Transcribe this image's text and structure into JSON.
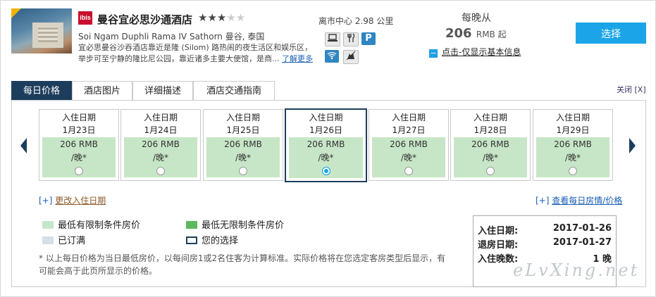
{
  "hotel": {
    "name": "曼谷宜必思沙通酒店",
    "brand": "ibis",
    "stars_filled": 3,
    "stars_total": 5,
    "address": "Soi Ngam Duphli Rama IV Sathorn 曼谷, 泰国",
    "desc_line1": "宜必思曼谷沙吞酒店靠近是隆 (Silom) 路热闹的夜生活区和娱乐区，",
    "desc_line2": "举步可至宁静的隆比尼公园，靠近诸多主要大使馆，是商...",
    "more_link": "了解更多",
    "distance": "离市中心 2.98 公里",
    "amenities": [
      "computer-icon",
      "restaurant-icon",
      "parking-icon",
      "wifi-icon",
      "pet-icon"
    ]
  },
  "pricing": {
    "label": "每晚从",
    "amount": "206",
    "currency": "RMB 起",
    "basic_info_link": "点击-仅显示基本信息",
    "select_button": "选择"
  },
  "tabs": [
    "每日价格",
    "酒店图片",
    "详细描述",
    "酒店交通指南"
  ],
  "close_label": "关闭 [X]",
  "calendar": {
    "checkin_label": "入住日期",
    "dates": [
      {
        "date": "1月23日",
        "price": "206 RMB",
        "per": "/晚*",
        "selected": false
      },
      {
        "date": "1月24日",
        "price": "206 RMB",
        "per": "/晚*",
        "selected": false
      },
      {
        "date": "1月25日",
        "price": "206 RMB",
        "per": "/晚*",
        "selected": false
      },
      {
        "date": "1月26日",
        "price": "206 RMB",
        "per": "/晚*",
        "selected": true
      },
      {
        "date": "1月27日",
        "price": "206 RMB",
        "per": "/晚*",
        "selected": false
      },
      {
        "date": "1月28日",
        "price": "206 RMB",
        "per": "/晚*",
        "selected": false
      },
      {
        "date": "1月29日",
        "price": "206 RMB",
        "per": "/晚*",
        "selected": false
      }
    ],
    "change_checkin_link": "更改入住日期",
    "view_daily_link": "查看每日房情/价格"
  },
  "legend": {
    "restricted": "最低有限制条件房价",
    "unrestricted": "最低无限制条件房价",
    "sold_out": "已订满",
    "your_choice": "您的选择",
    "colors": {
      "restricted": "#c7e6c7",
      "unrestricted": "#5cb85c",
      "sold_out": "#d6dfe8",
      "choice_border": "#1d3d5c"
    }
  },
  "note_line1": "* 以上每日价格为当日最低房价，以每间房1或2名住客为计算标准。实际价格将在您选定客房类型后显示，有",
  "note_line2": "可能会高于此页所显示的价格。",
  "summary": {
    "checkin_label": "入住日期:",
    "checkin_value": "2017-01-26",
    "checkout_label": "退房日期:",
    "checkout_value": "2017-01-27",
    "nights_label": "入住晚数:",
    "nights_value": "1 晚"
  },
  "watermark": "eLvXing.net"
}
